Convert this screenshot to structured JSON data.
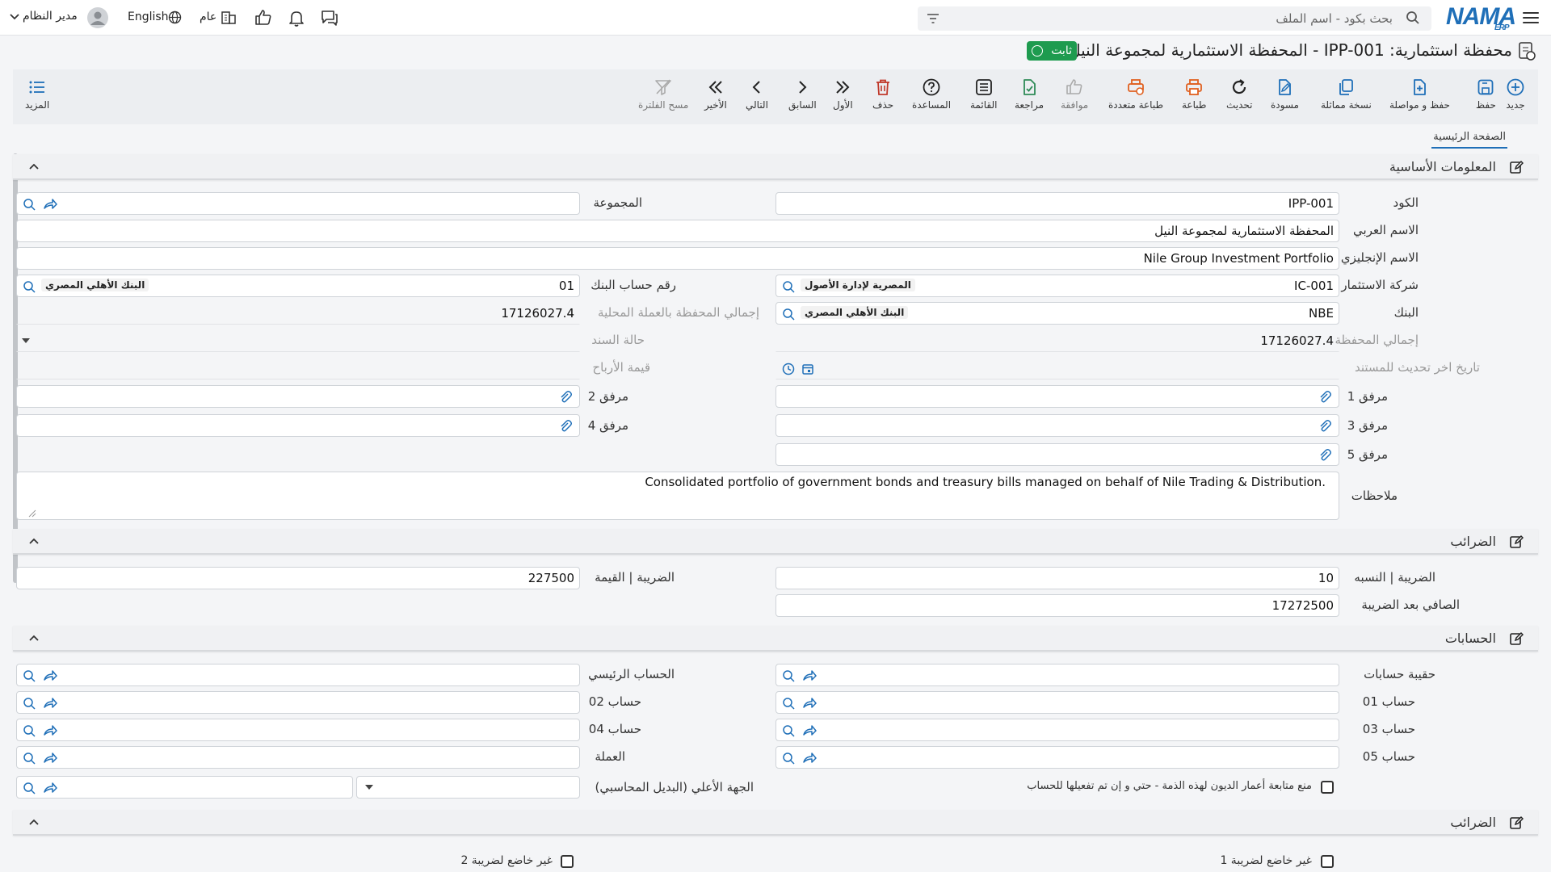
{
  "nav": {
    "brand": "NAMA",
    "brand_sub": "ERP",
    "search_placeholder": "بحث بكود - اسم الملف",
    "user": "مدير النظام",
    "language": "English",
    "scope": "عام"
  },
  "page": {
    "title": "محفظة استثمارية: IPP-001 - المحفظة الاستثمارية لمجموعة النيل",
    "status": "ثابت"
  },
  "toolbar": {
    "new": "جديد",
    "save": "حفظ",
    "save_continue": "حفظ و مواصلة",
    "duplicate": "نسخة مماثلة",
    "draft": "مسودة",
    "refresh": "تحديث",
    "print": "طباعة",
    "multi_print": "طباعة متعددة",
    "approve": "موافقة",
    "review": "مراجعة",
    "list": "القائمة",
    "help": "المساعدة",
    "delete": "حذف",
    "first": "الأول",
    "prev": "السابق",
    "next": "التالي",
    "last": "الأخير",
    "clear_filter": "مسح الفلترة",
    "more": "المزيد"
  },
  "tabs": {
    "main": "الصفحة الرئيسية"
  },
  "sections": {
    "basic": "المعلومات الأساسية",
    "taxes": "الضرائب",
    "accounts": "الحسابات",
    "taxes2": "الضرائب"
  },
  "basic": {
    "code_label": "الكود",
    "code": "IPP-001",
    "group_label": "المجموعة",
    "arabic_name_label": "الاسم العربي",
    "arabic_name": "المحفظة الاستثمارية لمجموعة النيل",
    "english_name_label": "الاسم الإنجليزي",
    "english_name": "Nile Group Investment Portfolio",
    "company_label": "شركة الاستثمار",
    "company_code": "IC-001",
    "company_name": "المصرية لإدارة الأصول",
    "bank_account_label": "رقم حساب البنك",
    "bank_account": "01",
    "bank_account_name": "البنك الأهلي المصري",
    "bank_label": "البنك",
    "bank_code": "NBE",
    "bank_name": "البنك الأهلي المصري",
    "local_total_label": "إجمالي المحفظة بالعملة المحلية",
    "local_total": "17126027.4",
    "total_label": "إجمالي المحفظة",
    "total": "17126027.4",
    "doc_status_label": "حالة السند",
    "last_update_label": "تاريخ اخر تحديث للمستند",
    "profit_label": "قيمة الأرباح",
    "att1_label": "مرفق 1",
    "att2_label": "مرفق 2",
    "att3_label": "مرفق 3",
    "att4_label": "مرفق 4",
    "att5_label": "مرفق 5",
    "notes_label": "ملاحظات",
    "notes": "Consolidated portfolio of government bonds and treasury bills managed on behalf of Nile Trading & Distribution."
  },
  "taxes": {
    "rate_label": "الضريبة | النسبه",
    "rate": "10",
    "value_label": "الضريبة | القيمة",
    "value": "227500",
    "net_label": "الصافي بعد الضريبة",
    "net": "17272500"
  },
  "accounts": {
    "bag_label": "حقيبة حسابات",
    "main_label": "الحساب الرئيسي",
    "acc01_label": "حساب 01",
    "acc02_label": "حساب 02",
    "acc03_label": "حساب 03",
    "acc04_label": "حساب 04",
    "acc05_label": "حساب 05",
    "currency_label": "العملة",
    "parent_label": "الجهة الأعلي (البديل المحاسبي)",
    "prevent_label": "منع متابعة أعمار الديون لهذه الذمة - حتي و إن تم تفعيلها للحساب"
  },
  "taxes2": {
    "exempt1_label": "غير خاضع لضريبة 1",
    "exempt2_label": "غير خاضع لضريبة 2"
  },
  "colors": {
    "accent": "#1f6fb8",
    "status": "#1e9b4f",
    "danger": "#c0392b",
    "approve": "#2e8b57",
    "print": "#e06020"
  }
}
